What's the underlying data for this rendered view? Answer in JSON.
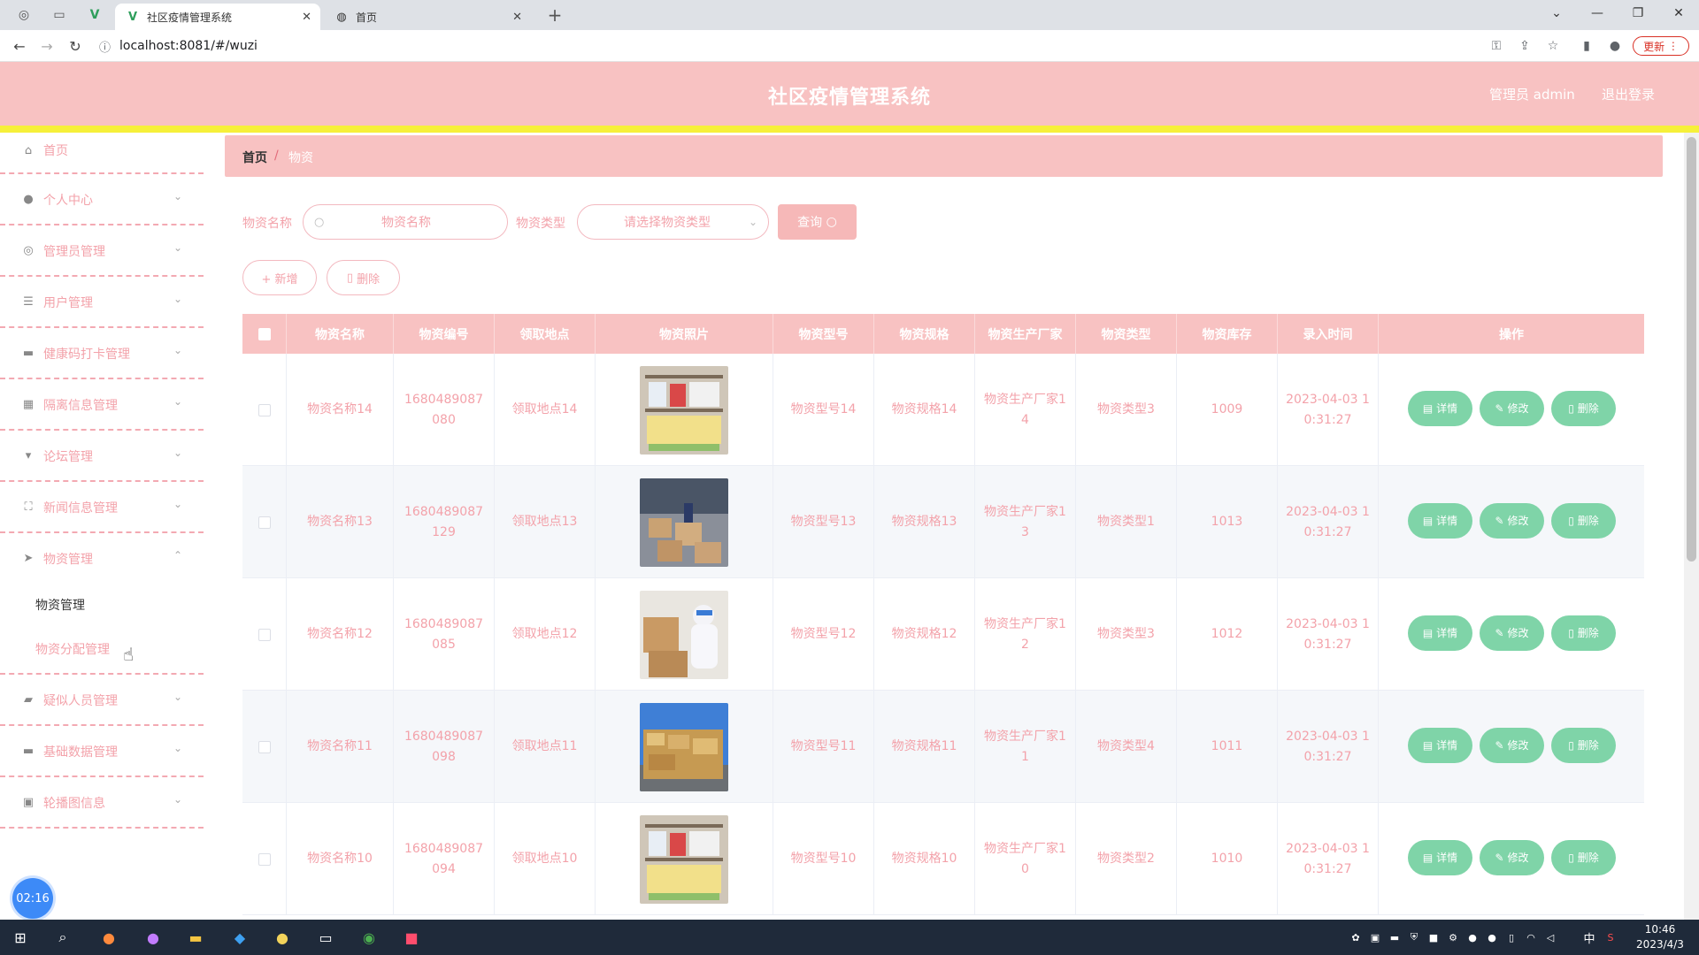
{
  "browser": {
    "tabs": [
      {
        "title": "社区疫情管理系统",
        "active": true
      },
      {
        "title": "首页",
        "active": false
      }
    ],
    "url": "localhost:8081/#/wuzi",
    "update_label": "更新"
  },
  "header": {
    "title": "社区疫情管理系统",
    "user": "管理员 admin",
    "logout": "退出登录"
  },
  "sidebar": {
    "items": [
      {
        "label": "首页",
        "icon": "home-icon"
      },
      {
        "label": "个人中心",
        "icon": "user-icon"
      },
      {
        "label": "管理员管理",
        "icon": "circle-icon"
      },
      {
        "label": "用户管理",
        "icon": "sliders-icon"
      },
      {
        "label": "健康码打卡管理",
        "icon": "briefcase-icon"
      },
      {
        "label": "隔离信息管理",
        "icon": "grid-icon"
      },
      {
        "label": "论坛管理",
        "icon": "forum-icon"
      },
      {
        "label": "新闻信息管理",
        "icon": "frame-icon"
      },
      {
        "label": "物资管理",
        "icon": "send-icon"
      },
      {
        "label": "疑似人员管理",
        "icon": "ticket-icon"
      },
      {
        "label": "基础数据管理",
        "icon": "device-icon"
      },
      {
        "label": "轮播图信息",
        "icon": "trash-icon"
      }
    ],
    "submenu": [
      "物资管理",
      "物资分配管理"
    ],
    "clock": "02:16"
  },
  "breadcrumb": {
    "home": "首页",
    "sep": "/",
    "current": "物资"
  },
  "filters": {
    "name_label": "物资名称",
    "name_placeholder": "物资名称",
    "type_label": "物资类型",
    "type_placeholder": "请选择物资类型",
    "search": "查询"
  },
  "actions": {
    "add": "+ 新增",
    "delete": "删除"
  },
  "table": {
    "columns": [
      "物资名称",
      "物资编号",
      "领取地点",
      "物资照片",
      "物资型号",
      "物资规格",
      "物资生产厂家",
      "物资类型",
      "物资库存",
      "录入时间",
      "操作"
    ],
    "rows": [
      {
        "name": "物资名称14",
        "code": "1680489087080",
        "place": "领取地点14",
        "model": "物资型号14",
        "spec": "物资规格14",
        "maker": "物资生产厂家14",
        "type": "物资类型3",
        "stock": "1009",
        "time": "2023-04-03 10:31:27"
      },
      {
        "name": "物资名称13",
        "code": "1680489087129",
        "place": "领取地点13",
        "model": "物资型号13",
        "spec": "物资规格13",
        "maker": "物资生产厂家13",
        "type": "物资类型1",
        "stock": "1013",
        "time": "2023-04-03 10:31:27"
      },
      {
        "name": "物资名称12",
        "code": "1680489087085",
        "place": "领取地点12",
        "model": "物资型号12",
        "spec": "物资规格12",
        "maker": "物资生产厂家12",
        "type": "物资类型3",
        "stock": "1012",
        "time": "2023-04-03 10:31:27"
      },
      {
        "name": "物资名称11",
        "code": "1680489087098",
        "place": "领取地点11",
        "model": "物资型号11",
        "spec": "物资规格11",
        "maker": "物资生产厂家11",
        "type": "物资类型4",
        "stock": "1011",
        "time": "2023-04-03 10:31:27"
      },
      {
        "name": "物资名称10",
        "code": "1680489087094",
        "place": "领取地点10",
        "model": "物资型号10",
        "spec": "物资规格10",
        "maker": "物资生产厂家10",
        "type": "物资类型2",
        "stock": "1010",
        "time": "2023-04-03 10:31:27"
      }
    ],
    "op_detail": "详情",
    "op_edit": "修改",
    "op_delete": "删除"
  },
  "taskbar": {
    "time": "10:46",
    "date": "2023/4/3",
    "ime": "中"
  }
}
